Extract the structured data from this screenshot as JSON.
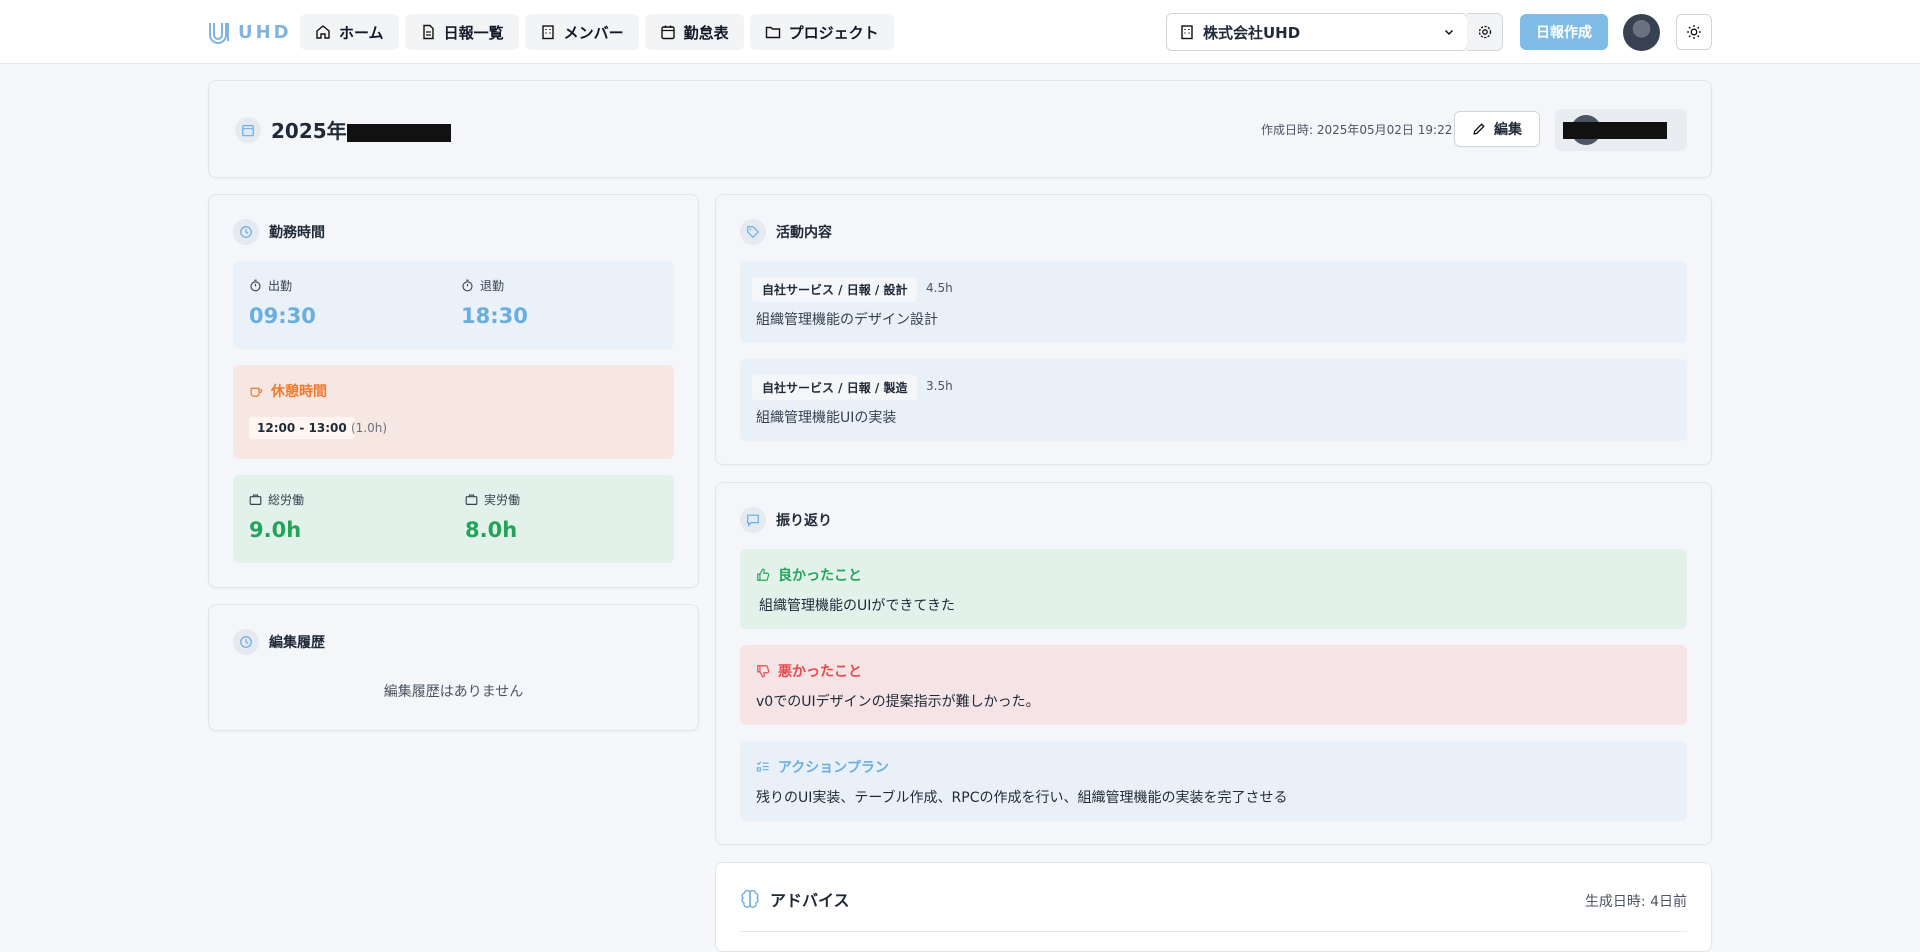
{
  "app": {
    "logo_text": "UHD",
    "brand_color": "#7fb4e0"
  },
  "nav": [
    {
      "label": "ホーム",
      "icon": "home-icon"
    },
    {
      "label": "日報一覧",
      "icon": "document-icon"
    },
    {
      "label": "メンバー",
      "icon": "building-icon"
    },
    {
      "label": "勤怠表",
      "icon": "calendar-icon"
    },
    {
      "label": "プロジェクト",
      "icon": "folder-icon"
    }
  ],
  "org": {
    "name": "株式会社UHD"
  },
  "header": {
    "create_label": "日報作成"
  },
  "report": {
    "title_prefix": "2025年",
    "created_at": "作成日時: 2025年05月02日 19:22",
    "edit_label": "編集"
  },
  "work": {
    "title": "勤務時間",
    "clock_in_label": "出勤",
    "clock_in": "09:30",
    "clock_out_label": "退勤",
    "clock_out": "18:30",
    "break_title": "休憩時間",
    "break_range": "12:00 - 13:00",
    "break_duration": "(1.0h)",
    "total_label": "総労働",
    "total": "9.0h",
    "actual_label": "実労働",
    "actual": "8.0h"
  },
  "history": {
    "title": "編集履歴",
    "empty": "編集履歴はありません"
  },
  "activity": {
    "title": "活動内容",
    "items": [
      {
        "tag": "自社サービス / 日報 / 設計",
        "hours": "4.5h",
        "desc": "組織管理機能のデザイン設計"
      },
      {
        "tag": "自社サービス / 日報 / 製造",
        "hours": "3.5h",
        "desc": "組織管理機能UIの実装"
      }
    ]
  },
  "reflection": {
    "title": "振り返り",
    "good_title": "良かったこと",
    "good_text": "組織管理機能のUIができてきた",
    "bad_title": "悪かったこと",
    "bad_text": "v0でのUIデザインの提案指示が難しかった。",
    "plan_title": "アクションプラン",
    "plan_text": "残りのUI実装、テーブル作成、RPCの作成を行い、組織管理機能の実装を完了させる"
  },
  "advice": {
    "title": "アドバイス",
    "generated": "生成日時: 4日前"
  },
  "colors": {
    "accent_blue": "#6aaee0",
    "green": "#22a55a",
    "orange": "#f07a2c",
    "red": "#e5484d"
  }
}
